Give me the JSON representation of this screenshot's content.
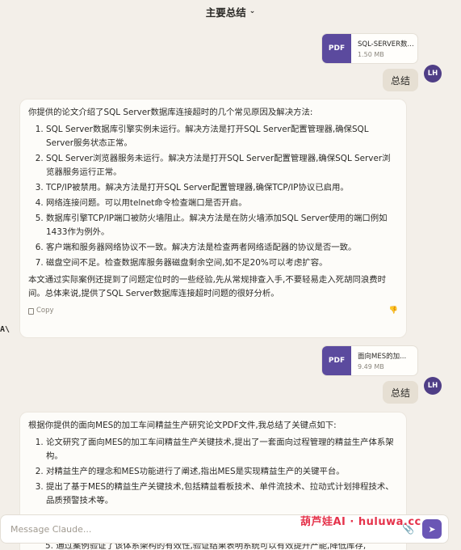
{
  "header": {
    "title": "主要总结",
    "chevron": "⌄"
  },
  "messages": [
    {
      "file": {
        "badge": "PDF",
        "name": "SQL-SERVER数...",
        "size": "1.50 MB"
      },
      "user_text": "总结",
      "avatar": "LH"
    },
    {
      "intro": "你提供的论文介绍了SQL Server数据库连接超时的几个常见原因及解决方法:",
      "items": [
        "SQL Server数据库引擎实例未运行。解决方法是打开SQL Server配置管理器,确保SQL Server服务状态正常。",
        "SQL Server浏览器服务未运行。解决方法是打开SQL Server配置管理器,确保SQL Server浏览器服务运行正常。",
        "TCP/IP被禁用。解决方法是打开SQL Server配置管理器,确保TCP/IP协议已启用。",
        "网络连接问题。可以用telnet命令检查端口是否开启。",
        "数据库引擎TCP/IP端口被防火墙阻止。解决方法是在防火墙添加SQL Server使用的端口例如1433作为例外。",
        "客户端和服务器网络协议不一致。解决方法是检查两者网络适配器的协议是否一致。",
        "磁盘空间不足。检查数据库服务器磁盘剩余空间,如不足20%可以考虑扩容。"
      ],
      "outro": "本文通过实际案例还提到了问题定位时的一些经验,先从常规排查入手,不要轻易走入死胡同浪费时间。总体来说,提供了SQL Server数据库连接超时问题的很好分析。",
      "copy_label": "Copy"
    },
    {
      "file": {
        "badge": "PDF",
        "name": "面向MES的加...",
        "size": "9.49 MB"
      },
      "user_text": "总结",
      "avatar": "LH"
    },
    {
      "intro": "根据你提供的面向MES的加工车间精益生产研究论文PDF文件,我总结了关键点如下:",
      "items": [
        "论文研究了面向MES的加工车间精益生产关键技术,提出了一套面向过程管理的精益生产体系架构。",
        "对精益生产的理念和MES功能进行了阐述,指出MES是实现精益生产的关键平台。",
        "提出了基于MES的精益生产关键技术,包括精益看板技术、单件流技术、拉动式计划排程技术、品质预警技术等。"
      ],
      "peek": "5. 通过案例验证了该体系架构的有效性,验证结果表明系统可以有效提升产能,降低库存,"
    }
  ],
  "claude_logo": "A\\",
  "input": {
    "placeholder": "Message Claude..."
  },
  "watermark": "葫芦娃AI · huluwa.cc"
}
